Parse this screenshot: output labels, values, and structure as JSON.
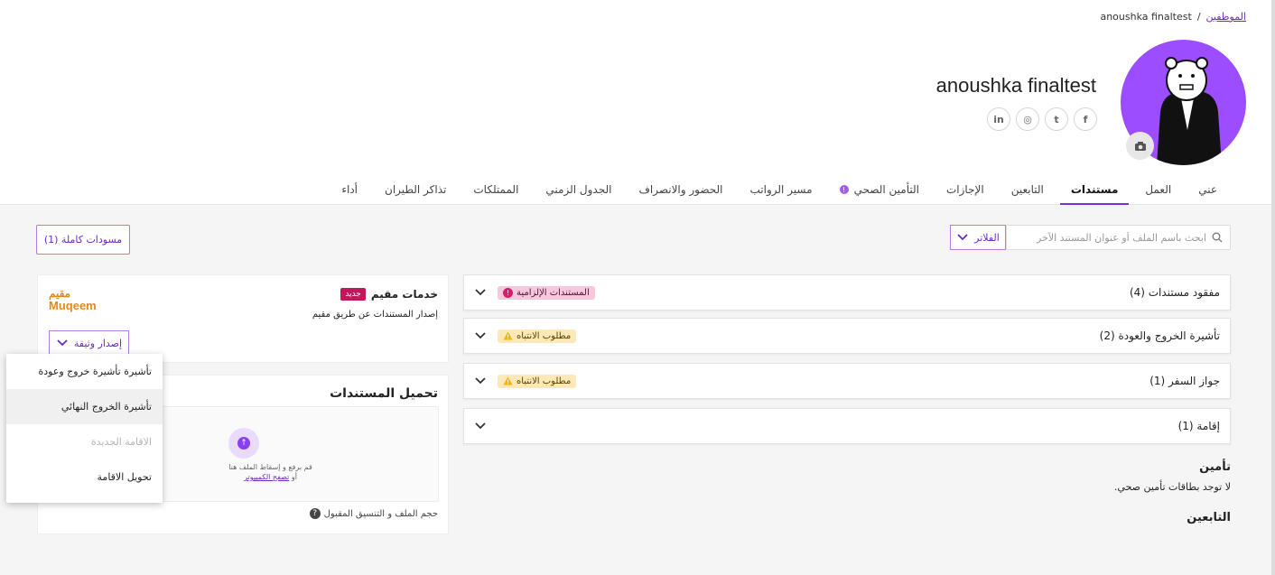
{
  "breadcrumb": {
    "parent": "الموظفين",
    "separator": "/",
    "current": "anoushka finaltest"
  },
  "profile": {
    "name": "anoushka finaltest"
  },
  "socials": [
    {
      "icon": "facebook-icon",
      "glyph": "f"
    },
    {
      "icon": "twitter-icon",
      "glyph": "t"
    },
    {
      "icon": "instagram-icon",
      "glyph": "◎"
    },
    {
      "icon": "linkedin-icon",
      "glyph": "in"
    }
  ],
  "tabs": [
    {
      "label": "عني",
      "active": false
    },
    {
      "label": "العمل",
      "active": false
    },
    {
      "label": "مستندات",
      "active": true
    },
    {
      "label": "التابعين",
      "active": false
    },
    {
      "label": "الإجازات",
      "active": false
    },
    {
      "label": "التأمين الصحي",
      "active": false,
      "badge": "!"
    },
    {
      "label": "مسير الرواتب",
      "active": false
    },
    {
      "label": "الحضور والانصراف",
      "active": false
    },
    {
      "label": "الجدول الزمني",
      "active": false
    },
    {
      "label": "الممتلكات",
      "active": false
    },
    {
      "label": "تذاكر الطيران",
      "active": false
    },
    {
      "label": "أداء",
      "active": false
    }
  ],
  "toolbar": {
    "drafts_label": "مسودات كاملة (1)",
    "search_placeholder": "ابحث باسم الملف أو عنوان المستند الآخر",
    "filter_label": "الفلاتر"
  },
  "accordions": [
    {
      "title": "مفقود مستندات (4)",
      "pill": "المستندات الإلزامية",
      "pill_type": "mand"
    },
    {
      "title": "تأشيرة الخروج والعودة (2)",
      "pill": "مطلوب الانتباه",
      "pill_type": "warn"
    },
    {
      "title": "جواز السفر (1)",
      "pill": "مطلوب الانتباه",
      "pill_type": "warn"
    },
    {
      "title": "إقامة (1)",
      "pill": "",
      "pill_type": ""
    }
  ],
  "insurance": {
    "heading": "تأمين",
    "text": "لا توجد بطاقات تأمين صحي."
  },
  "dependents": {
    "heading": "التابعين"
  },
  "muqeem": {
    "title": "خدمات مقيم",
    "new_badge": "جديد",
    "subtitle": "إصدار المستندات عن طريق مقيم",
    "logo_ar": "مقيم",
    "logo_en": "Muqeem",
    "issue_button": "إصدار وثيقة"
  },
  "upload": {
    "title": "تحميل المستندات",
    "drop_text": "قم برفع و إسقاط الملف هنا",
    "or_text": "أو",
    "browse_text": "تصفح الكمبيوتر",
    "size_note": "حجم الملف و التنسيق المقبول"
  },
  "dropdown": {
    "items": [
      {
        "label": "تأشيرة تأشيرة خروج وعودة",
        "state": "normal"
      },
      {
        "label": "تأشيرة الخروج النهائي",
        "state": "hover"
      },
      {
        "label": "الاقامة الجديدة",
        "state": "disabled"
      },
      {
        "label": "تحويل الاقامة",
        "state": "normal"
      }
    ]
  },
  "colors": {
    "accent": "#7b2fd6",
    "avatar_bg": "#9b4dff",
    "mandatory": "#d81b6a",
    "warning": "#f5b400",
    "muqeem": "#e08a1e"
  }
}
